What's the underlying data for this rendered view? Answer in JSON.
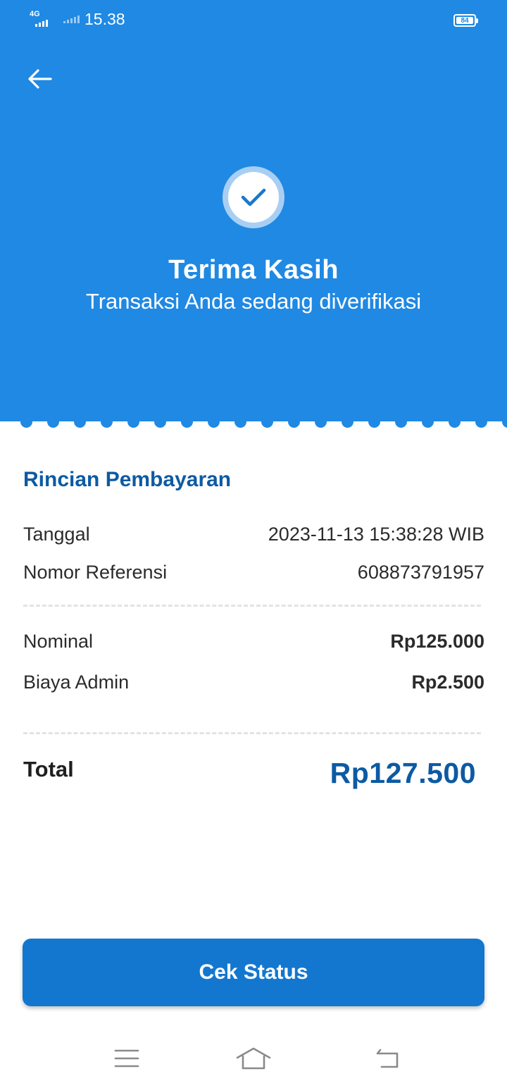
{
  "status_bar": {
    "network_label": "4G",
    "time": "15.38",
    "battery": "84"
  },
  "header": {
    "back_icon": "arrow-left-icon",
    "status_icon": "check-icon",
    "title": "Terima Kasih",
    "subtitle": "Transaksi Anda sedang diverifikasi"
  },
  "details": {
    "section_title": "Rincian Pembayaran",
    "rows": [
      {
        "label": "Tanggal",
        "value": "2023-11-13 15:38:28 WIB"
      },
      {
        "label": "Nomor Referensi",
        "value": "608873791957"
      },
      {
        "label": "Nominal",
        "value": "Rp125.000"
      },
      {
        "label": "Biaya Admin",
        "value": "Rp2.500"
      }
    ],
    "total_label": "Total",
    "total_value": "Rp127.500"
  },
  "action": {
    "button_label": "Cek Status"
  },
  "nav": {
    "icons": [
      "menu-icon",
      "home-icon",
      "back-icon"
    ]
  },
  "colors": {
    "primary": "#2089e3",
    "accent_dark": "#0d5aa3",
    "button": "#1377cf"
  }
}
